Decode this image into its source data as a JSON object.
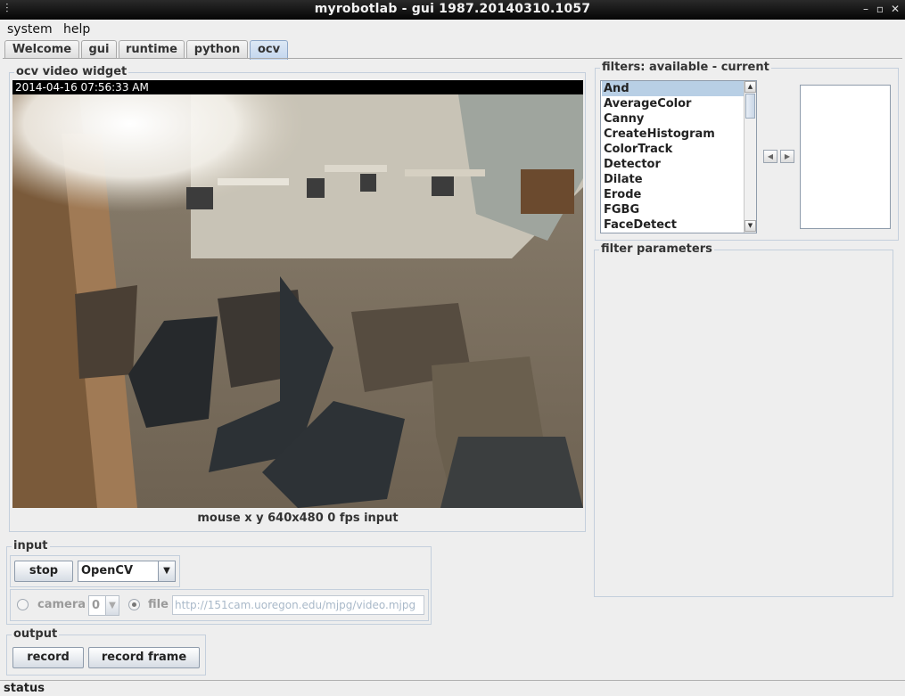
{
  "window": {
    "title": "myrobotlab - gui 1987.20140310.1057",
    "pin_glyph": "⫶",
    "minimize_glyph": "–",
    "maximize_glyph": "▫",
    "close_glyph": "✕"
  },
  "menu": {
    "items": [
      "system",
      "help"
    ]
  },
  "tabs": {
    "items": [
      "Welcome",
      "gui",
      "runtime",
      "python",
      "ocv"
    ],
    "active": "ocv"
  },
  "video_widget": {
    "title": "ocv video widget",
    "timestamp": "2014-04-16 07:56:33 AM",
    "info": "mouse x y 640x480 0 fps input"
  },
  "input": {
    "title": "input",
    "stop_label": "stop",
    "grabber_value": "OpenCV",
    "camera_label": "camera",
    "camera_index": "0",
    "file_label": "file",
    "file_value": "http://151cam.uoregon.edu/mjpg/video.mjpg",
    "source_selected": "file"
  },
  "output": {
    "title": "output",
    "record_label": "record",
    "record_frame_label": "record frame"
  },
  "filters": {
    "title": "filters: available - current",
    "available": [
      "And",
      "AverageColor",
      "Canny",
      "CreateHistogram",
      "ColorTrack",
      "Detector",
      "Dilate",
      "Erode",
      "FGBG",
      "FaceDetect"
    ],
    "selected": "And",
    "current": [],
    "add_glyph": "◀",
    "remove_glyph": "▶"
  },
  "filter_parameters": {
    "title": "filter parameters"
  },
  "status": {
    "label": "status"
  },
  "scroll": {
    "up_glyph": "▲",
    "down_glyph": "▼"
  },
  "combo_arrow": "▼"
}
